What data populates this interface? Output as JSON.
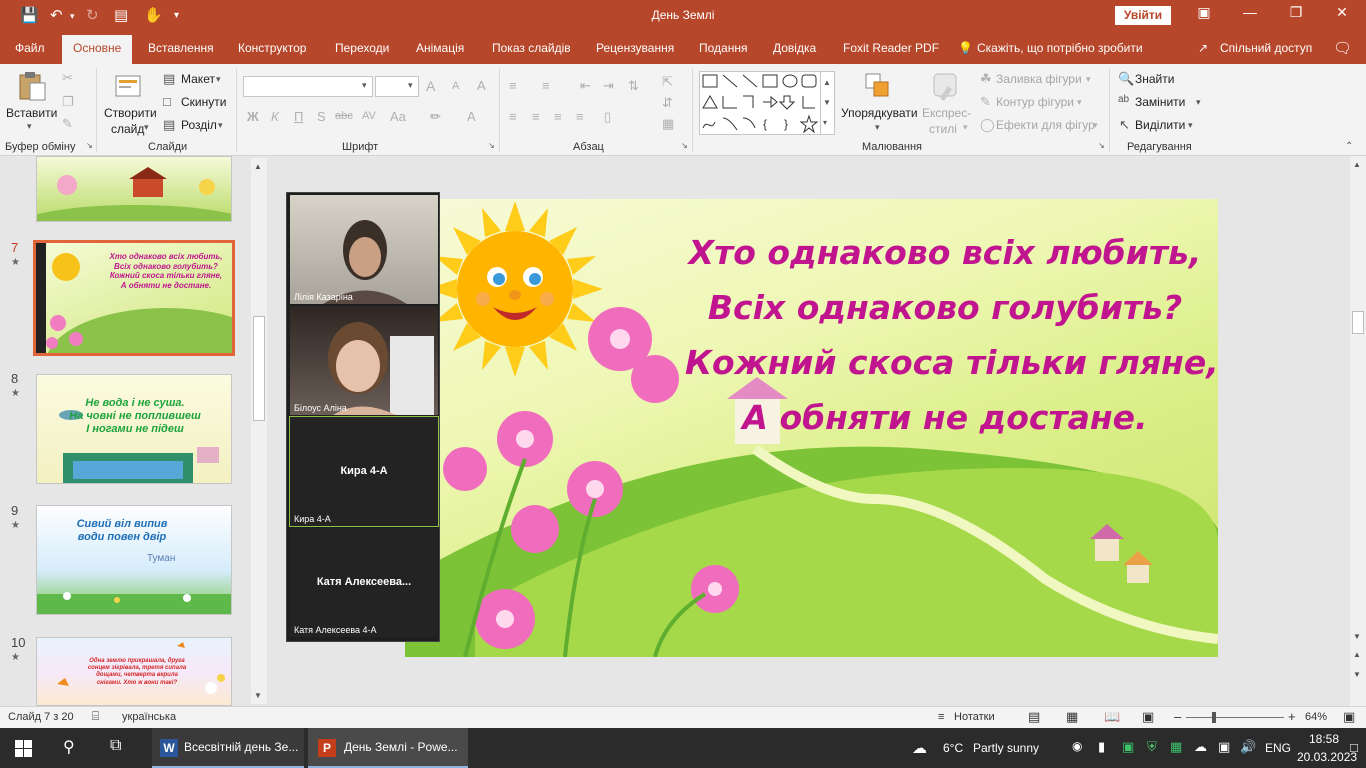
{
  "window": {
    "title": "День Землі",
    "signin_label": "Увійти"
  },
  "menu": {
    "tabs": [
      "Файл",
      "Основне",
      "Вставлення",
      "Конструктор",
      "Переходи",
      "Анімація",
      "Показ слайдів",
      "Рецензування",
      "Подання",
      "Довідка",
      "Foxit Reader PDF"
    ],
    "tell_me": "Скажіть, що потрібно зробити",
    "share": "Спільний доступ"
  },
  "ribbon": {
    "clipboard": {
      "paste": "Вставити",
      "label": "Буфер обміну"
    },
    "slides": {
      "new_slide_line1": "Створити",
      "new_slide_line2": "слайд",
      "layout": "Макет",
      "reset": "Скинути",
      "section": "Розділ",
      "label": "Слайди"
    },
    "font": {
      "label": "Шрифт",
      "bold": "Ж",
      "italic": "К",
      "underline": "П",
      "strike": "S",
      "strike2": "abc",
      "spacing": "AV",
      "case": "Aa",
      "grow": "A",
      "shrink": "A",
      "clear": "A"
    },
    "paragraph": {
      "label": "Абзац"
    },
    "drawing": {
      "arrange": "Упорядкувати",
      "quick_styles_line1": "Експрес-",
      "quick_styles_line2": "стилі",
      "fill": "Заливка фігури",
      "outline": "Контур фігури",
      "effects": "Ефекти для фігур",
      "label": "Малювання"
    },
    "editing": {
      "find": "Знайти",
      "replace": "Замінити",
      "select": "Виділити",
      "label": "Редагування"
    }
  },
  "thumbnails": [
    {
      "num": "",
      "lines": []
    },
    {
      "num": "7",
      "lines": [
        "Хто однаково всіх любить,",
        "Всіх однаково голубить?",
        "Кожний скоса тільки гляне,",
        "А обняти не достане."
      ]
    },
    {
      "num": "8",
      "lines": [
        "Не вода і не суша.",
        "На човні не поплившеш",
        "І ногами не підеш"
      ]
    },
    {
      "num": "9",
      "lines": [
        "Сивий віл випив",
        "води повен двір"
      ],
      "extra": "Туман"
    },
    {
      "num": "10",
      "lines": [
        "Одна землю прикрашала, друга",
        "сонцем зігрівала, третя сипала",
        "дощами, четверта вкрила",
        "снігами. Хто ж вони такі?"
      ]
    }
  ],
  "slide": {
    "lines": [
      "Хто однаково всіх любить,",
      "Всіх однаково голубить?",
      "Кожний скоса тільки гляне,",
      "А обняти не достане."
    ]
  },
  "zoom": {
    "tiles": [
      {
        "name": "Лілія Казаріна",
        "center": ""
      },
      {
        "name": "Білоус Аліна",
        "center": ""
      },
      {
        "name": "Кира 4-А",
        "center": "Кира 4-А"
      },
      {
        "name": "Катя Алексеева 4-А",
        "center": "Катя  Алексеева..."
      }
    ]
  },
  "status": {
    "slide_info": "Слайд 7 з 20",
    "language": "українська",
    "notes": "Нотатки",
    "zoom_level": "64%"
  },
  "taskbar": {
    "word_task": "Всесвітній день Зе...",
    "ppt_task": "День Землі - Powe...",
    "temperature": "6°C",
    "weather": "Partly sunny",
    "lang": "ENG",
    "time": "18:58",
    "date": "20.03.2023"
  }
}
